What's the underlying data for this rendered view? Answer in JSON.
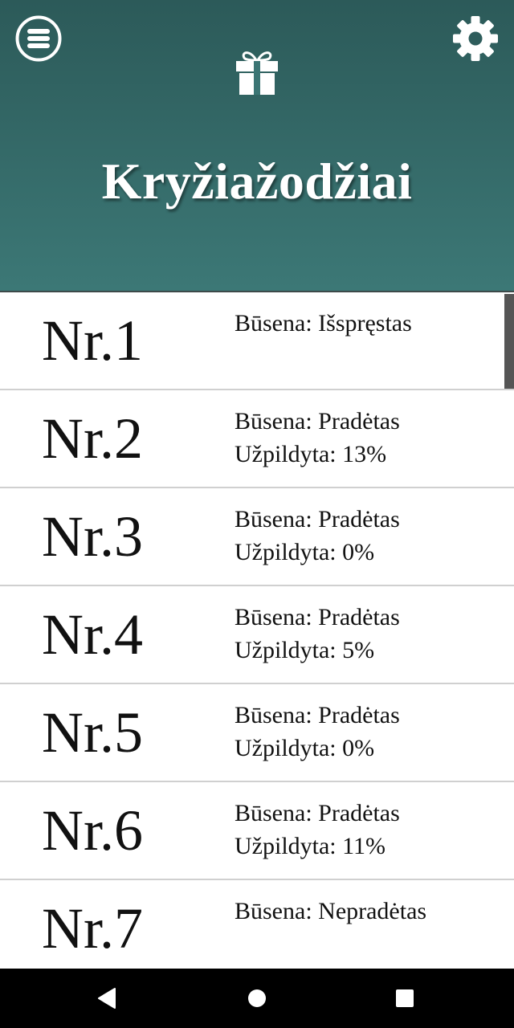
{
  "header": {
    "title": "Kryžiažodžiai",
    "menu_icon": "menu-icon",
    "gift_icon": "gift-icon",
    "settings_icon": "gear-icon",
    "bg_top": "#2c5a59",
    "bg_bottom": "#3c7876"
  },
  "puzzles": [
    {
      "number": "Nr.1",
      "status": "Būsena: Išspręstas",
      "progress": ""
    },
    {
      "number": "Nr.2",
      "status": "Būsena: Pradėtas",
      "progress": "Užpildyta: 13%"
    },
    {
      "number": "Nr.3",
      "status": "Būsena: Pradėtas",
      "progress": "Užpildyta: 0%"
    },
    {
      "number": "Nr.4",
      "status": "Būsena: Pradėtas",
      "progress": "Užpildyta: 5%"
    },
    {
      "number": "Nr.5",
      "status": "Būsena: Pradėtas",
      "progress": "Užpildyta: 0%"
    },
    {
      "number": "Nr.6",
      "status": "Būsena: Pradėtas",
      "progress": "Užpildyta: 11%"
    },
    {
      "number": "Nr.7",
      "status": "Būsena: Nepradėtas",
      "progress": ""
    }
  ],
  "navbar": {
    "back_icon": "back-triangle-icon",
    "home_icon": "home-circle-icon",
    "recent_icon": "recent-square-icon"
  }
}
